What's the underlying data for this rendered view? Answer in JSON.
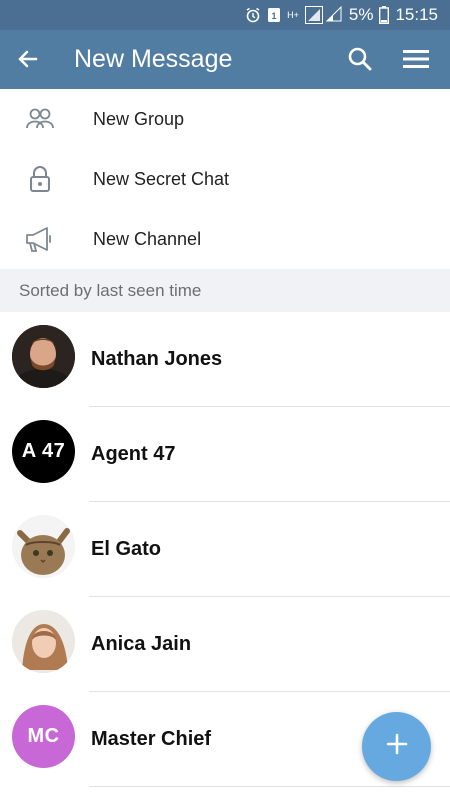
{
  "status_bar": {
    "battery": "5%",
    "time": "15:15",
    "network": "H+"
  },
  "header": {
    "title": "New Message",
    "back_icon": "arrow-left-icon",
    "search_icon": "search-icon",
    "menu_icon": "menu-icon"
  },
  "actions": [
    {
      "label": "New Group",
      "icon": "group-icon"
    },
    {
      "label": "New Secret Chat",
      "icon": "lock-icon"
    },
    {
      "label": "New Channel",
      "icon": "megaphone-icon"
    }
  ],
  "section_header": "Sorted by last seen time",
  "contacts": [
    {
      "name": "Nathan Jones",
      "initials": "",
      "avatar_type": "photo",
      "avatar_color": "#3b2a22"
    },
    {
      "name": "Agent 47",
      "initials": "A 47",
      "avatar_type": "initials",
      "avatar_color": "#000000"
    },
    {
      "name": "El Gato",
      "initials": "",
      "avatar_type": "photo",
      "avatar_color": "#9a7a55"
    },
    {
      "name": "Anica Jain",
      "initials": "",
      "avatar_type": "photo",
      "avatar_color": "#c9a48a"
    },
    {
      "name": "Master Chief",
      "initials": "MC",
      "avatar_type": "initials",
      "avatar_color": "#c868d6"
    }
  ],
  "fab": {
    "icon": "plus-icon",
    "color": "#65a9e0"
  },
  "colors": {
    "app_bar": "#527da3",
    "status_bar": "#4a6f92"
  }
}
